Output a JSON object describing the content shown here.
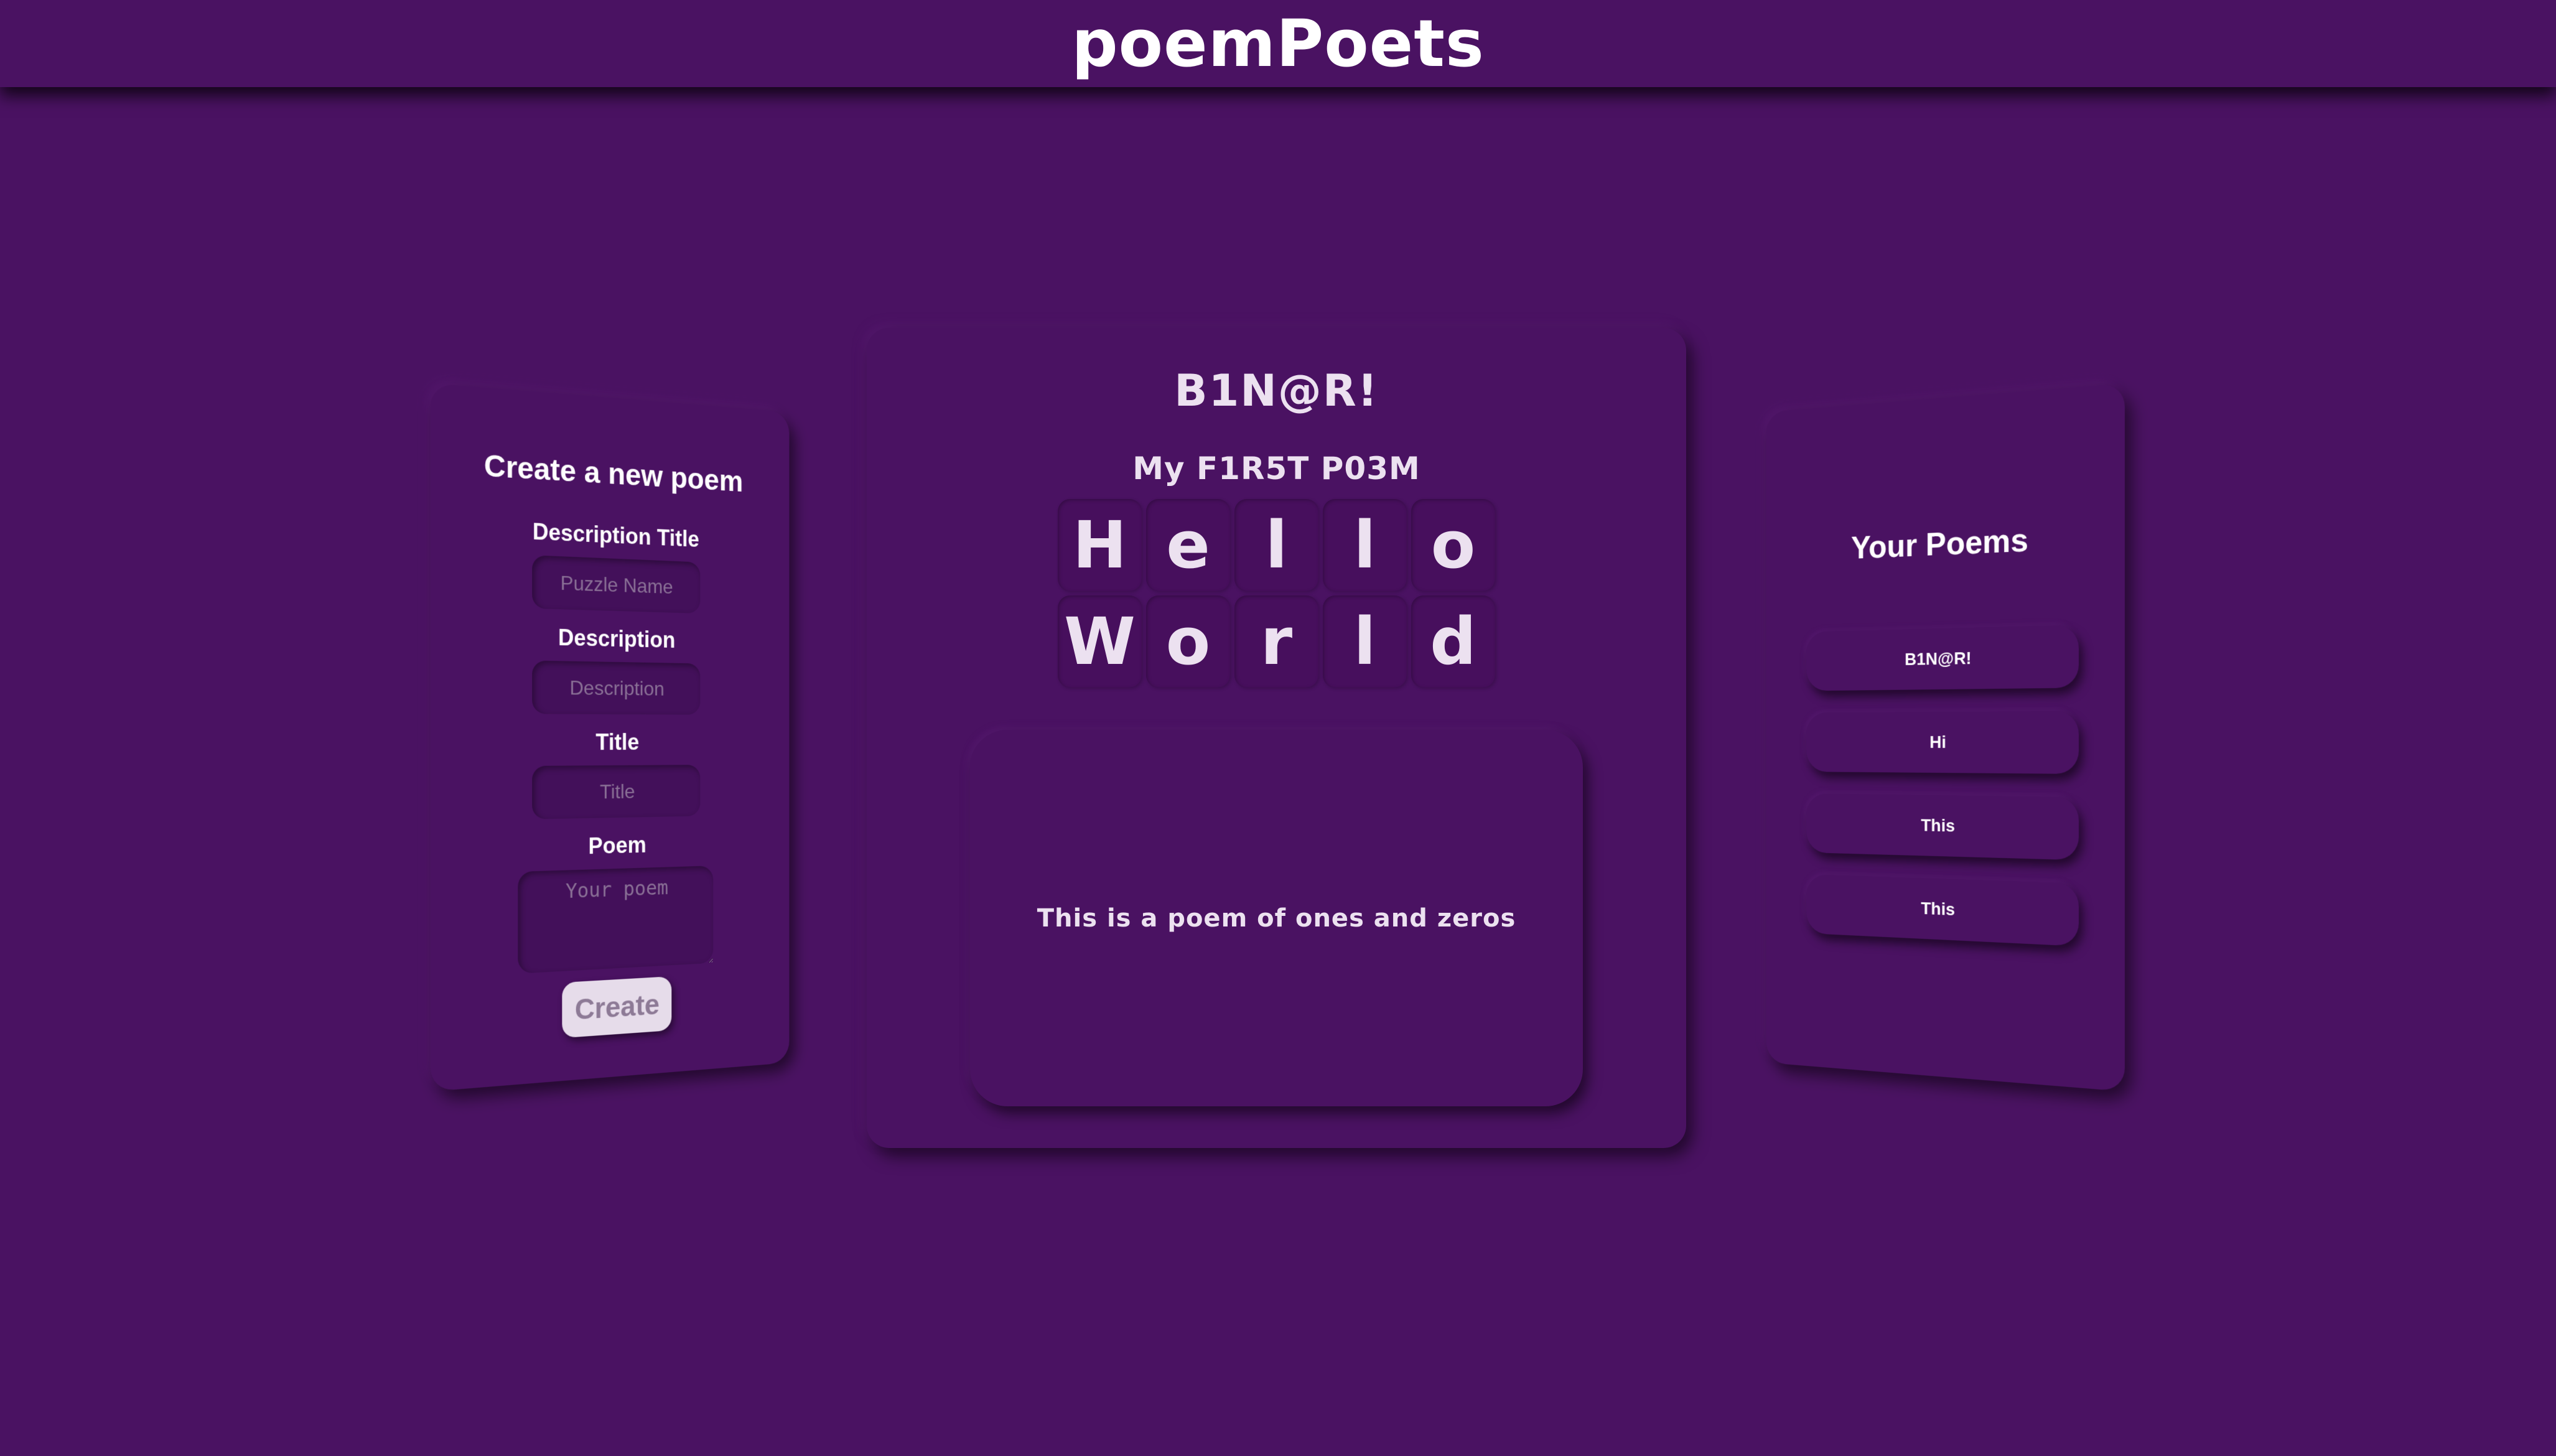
{
  "header": {
    "site_title": "poemPoets"
  },
  "create_form": {
    "heading": "Create a new poem",
    "description_title_label": "Description Title",
    "description_title_placeholder": "Puzzle Name",
    "description_label": "Description",
    "description_placeholder": "Description",
    "title_label": "Title",
    "title_placeholder": "Title",
    "poem_label": "Poem",
    "poem_placeholder": "Your poem",
    "create_button": "Create"
  },
  "poem_view": {
    "title": "B1N@R!",
    "subtitle": "My F1R5T P03M",
    "tiles": [
      "H",
      "e",
      "l",
      "l",
      "o",
      "W",
      "o",
      "r",
      "l",
      "d"
    ],
    "body": "This is a poem of ones and zeros"
  },
  "your_poems": {
    "heading": "Your Poems",
    "items": [
      "B1N@R!",
      "Hi",
      "This",
      "This"
    ]
  }
}
